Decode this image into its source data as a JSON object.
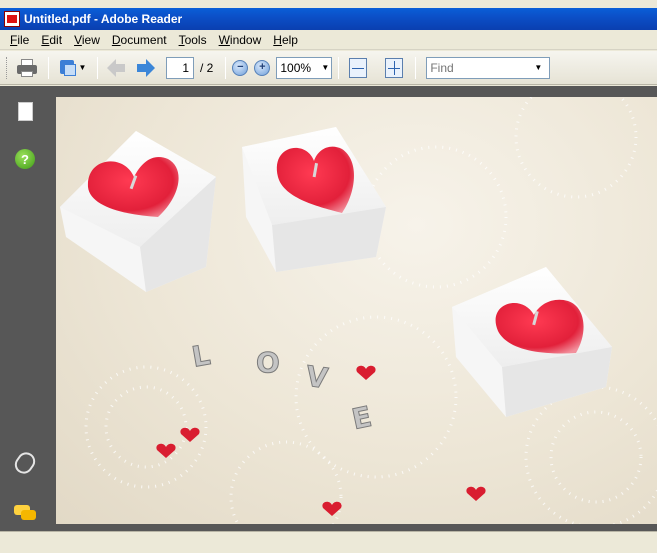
{
  "window": {
    "title": "Untitled.pdf - Adobe Reader"
  },
  "menubar": {
    "items": [
      {
        "label": "File",
        "acc": "F",
        "rest": "ile"
      },
      {
        "label": "Edit",
        "acc": "E",
        "rest": "dit"
      },
      {
        "label": "View",
        "acc": "V",
        "rest": "iew"
      },
      {
        "label": "Document",
        "acc": "D",
        "rest": "ocument"
      },
      {
        "label": "Tools",
        "acc": "T",
        "rest": "ools"
      },
      {
        "label": "Window",
        "acc": "W",
        "rest": "indow"
      },
      {
        "label": "Help",
        "acc": "H",
        "rest": "elp"
      }
    ]
  },
  "toolbar": {
    "current_page": "1",
    "page_total": "/ 2",
    "zoom_out_symbol": "−",
    "zoom_in_symbol": "+",
    "zoom": "100%",
    "find_placeholder": "Find"
  },
  "sidenav": {
    "help_symbol": "?"
  },
  "document": {
    "photo_letters": [
      "L",
      "O",
      "V",
      "E"
    ]
  },
  "colors": {
    "titlebar": "#0a4fc7",
    "panel": "#575757",
    "heart": "#e2203a",
    "nav_forward": "#3b86d8"
  },
  "icons": [
    "printer-icon",
    "share-icon",
    "previous-page-icon",
    "next-page-icon",
    "zoom-out-icon",
    "zoom-in-icon",
    "fit-width-icon",
    "fit-page-icon",
    "pages-icon",
    "help-icon",
    "attachment-icon",
    "comments-icon"
  ]
}
